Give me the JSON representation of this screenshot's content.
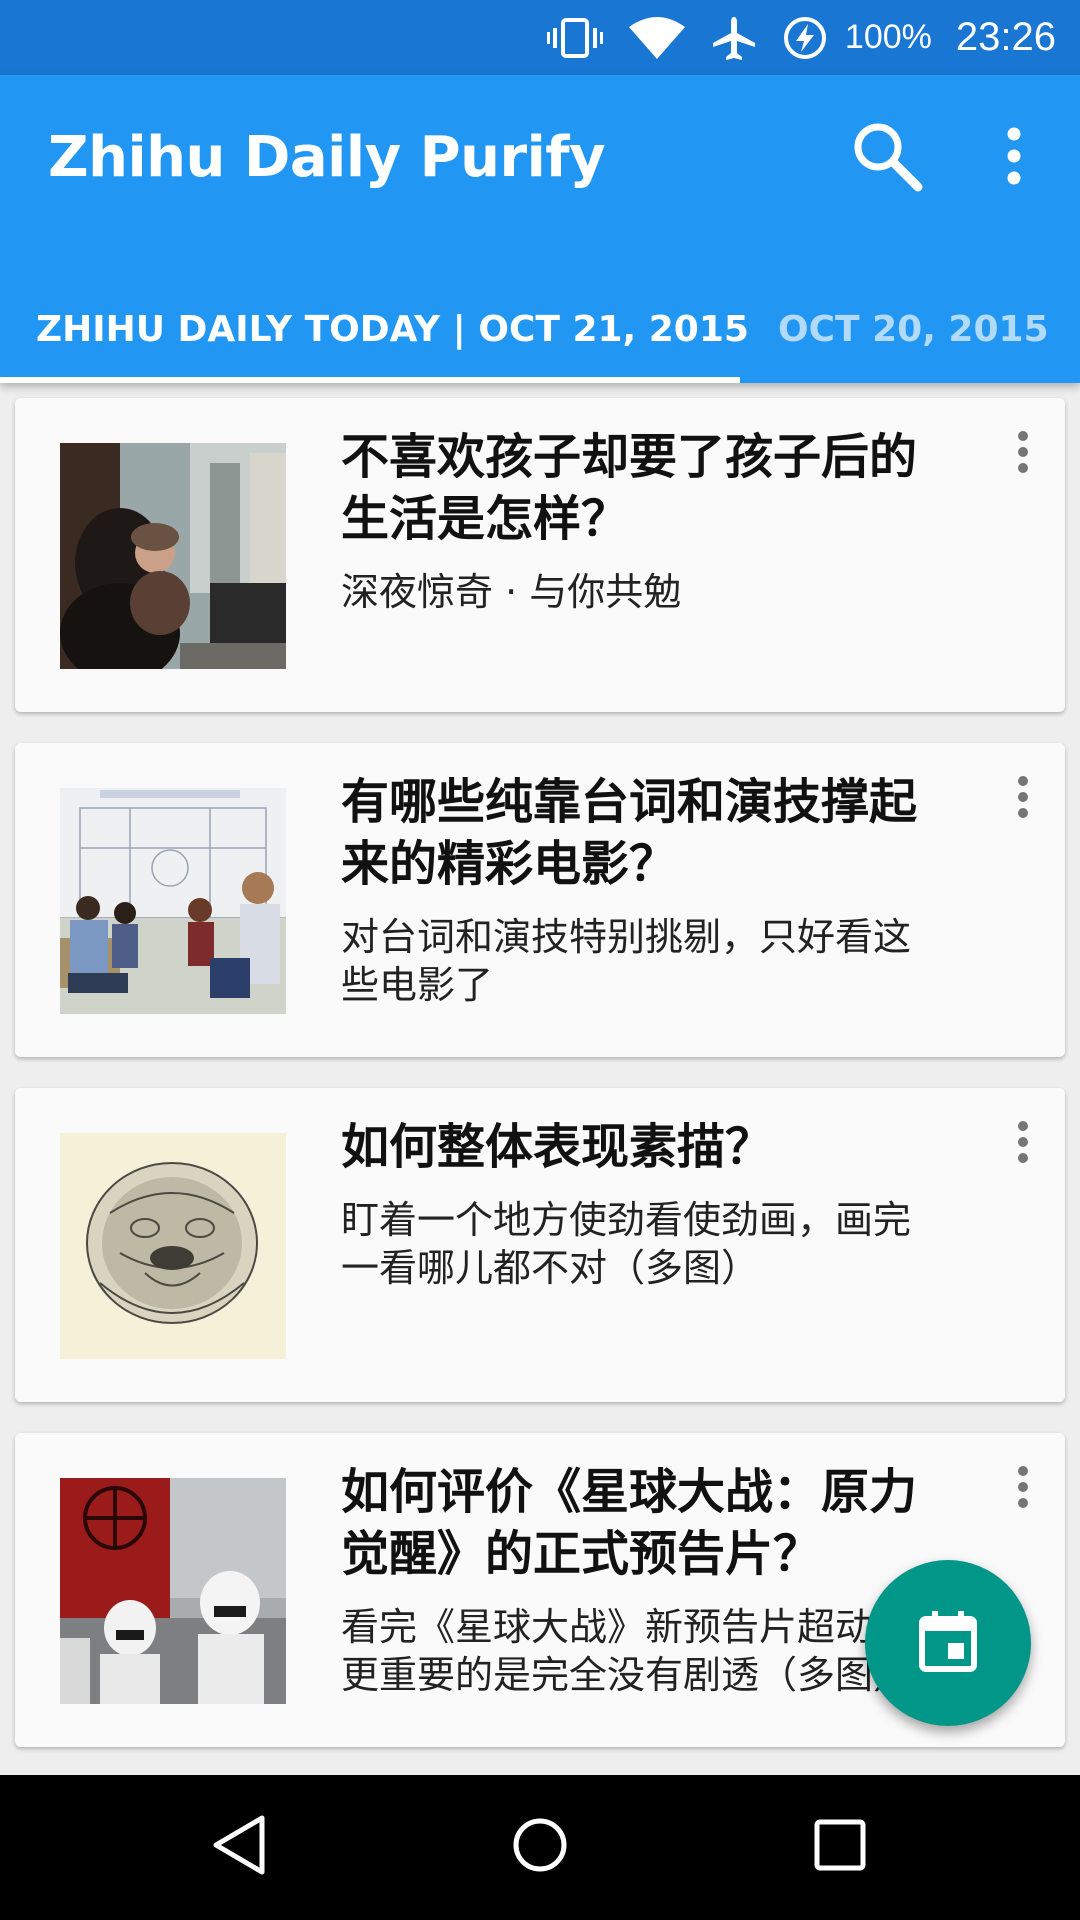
{
  "status_bar": {
    "icons": [
      "vibrate-icon",
      "wifi-icon",
      "airplane-mode-icon",
      "battery-charging-icon"
    ],
    "battery": "100%",
    "time": "23:26"
  },
  "app_bar": {
    "title": "Zhihu Daily Purify",
    "actions": [
      "search-icon",
      "more-vert-icon"
    ]
  },
  "tabs": [
    {
      "label": "ZHIHU DAILY TODAY | OCT 21, 2015",
      "selected": true
    },
    {
      "label": "OCT 20, 2015",
      "selected": false
    }
  ],
  "stories": [
    {
      "title": "不喜欢孩子却要了孩子后的生活是怎样？",
      "subtitle": "深夜惊奇 · 与你共勉"
    },
    {
      "title": "有哪些纯靠台词和演技撑起来的精彩电影？",
      "subtitle": "对台词和演技特别挑剔，只好看这些电影了"
    },
    {
      "title": "如何整体表现素描？",
      "subtitle": "盯着一个地方使劲看使劲画，画完一看哪儿都不对（多图）"
    },
    {
      "title": "如何评价《星球大战：原力觉醒》的正式预告片？",
      "subtitle": "看完《星球大战》新预告片超动，更重要的是完全没有剧透（多图）"
    }
  ],
  "fab": {
    "icon": "calendar-icon"
  },
  "nav_bar": {
    "buttons": [
      "back-icon",
      "home-icon",
      "recents-icon"
    ]
  },
  "colors": {
    "status_bar": "#1976d2",
    "app_bar": "#2196f3",
    "fab": "#009688",
    "background": "#eeeeee",
    "card": "#fafafa"
  }
}
